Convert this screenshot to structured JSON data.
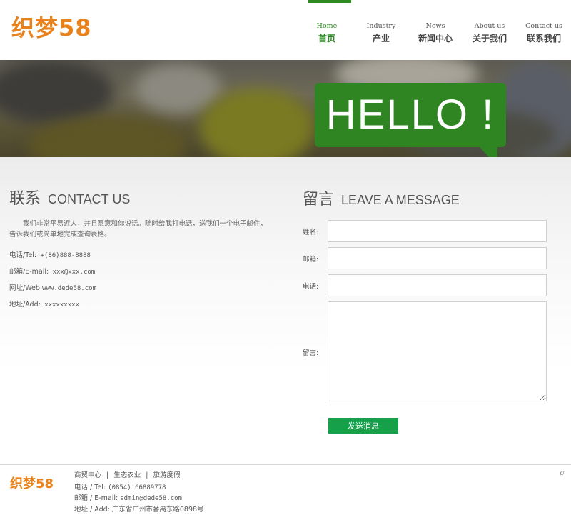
{
  "header": {
    "logo_text": "织梦58",
    "nav": [
      {
        "en": "Home",
        "zh": "首页"
      },
      {
        "en": "Industry",
        "zh": "产业"
      },
      {
        "en": "News",
        "zh": "新闻中心"
      },
      {
        "en": "About us",
        "zh": "关于我们"
      },
      {
        "en": "Contact us",
        "zh": "联系我们"
      }
    ]
  },
  "banner": {
    "hello_text": "HELLO !"
  },
  "contact": {
    "title_zh": "联系",
    "title_en": "CONTACT US",
    "intro": "我们非常平易近人，并且愿意和你说话。随时给我打电话，送我们一个电子邮件，告诉我们或简单地完成查询表格。",
    "lines": [
      {
        "label": "电话/Tel:",
        "value": " +(86)888-8888"
      },
      {
        "label": "邮箱/E-mail:",
        "value": " xxx@xxx.com"
      },
      {
        "label": "网址/Web:",
        "value": "www.dede58.com"
      },
      {
        "label": "地址/Add:",
        "value": " xxxxxxxxx"
      }
    ]
  },
  "message": {
    "title_zh": "留言",
    "title_en": "LEAVE A MESSAGE",
    "name_label": "姓名:",
    "email_label": "邮箱:",
    "phone_label": "电话:",
    "message_label": "留言:",
    "submit_label": "发送消息"
  },
  "footer": {
    "logo_text": "织梦58",
    "links": [
      "商贸中心",
      "生态农业",
      "旅游度假"
    ],
    "separator": "|",
    "tel_label": "电话 / Tel:",
    "tel_value": "(0854) 66889778",
    "email_label": "邮箱 / E-mail:",
    "email_value": "admin@dede58.com",
    "addr_label": "地址 / Add:",
    "addr_value": "广东省广州市番禺东路0898号",
    "copyright": "©"
  },
  "colors": {
    "brand_orange": "#e7821c",
    "accent_green": "#2f8a23",
    "button_green": "#17a04a"
  }
}
